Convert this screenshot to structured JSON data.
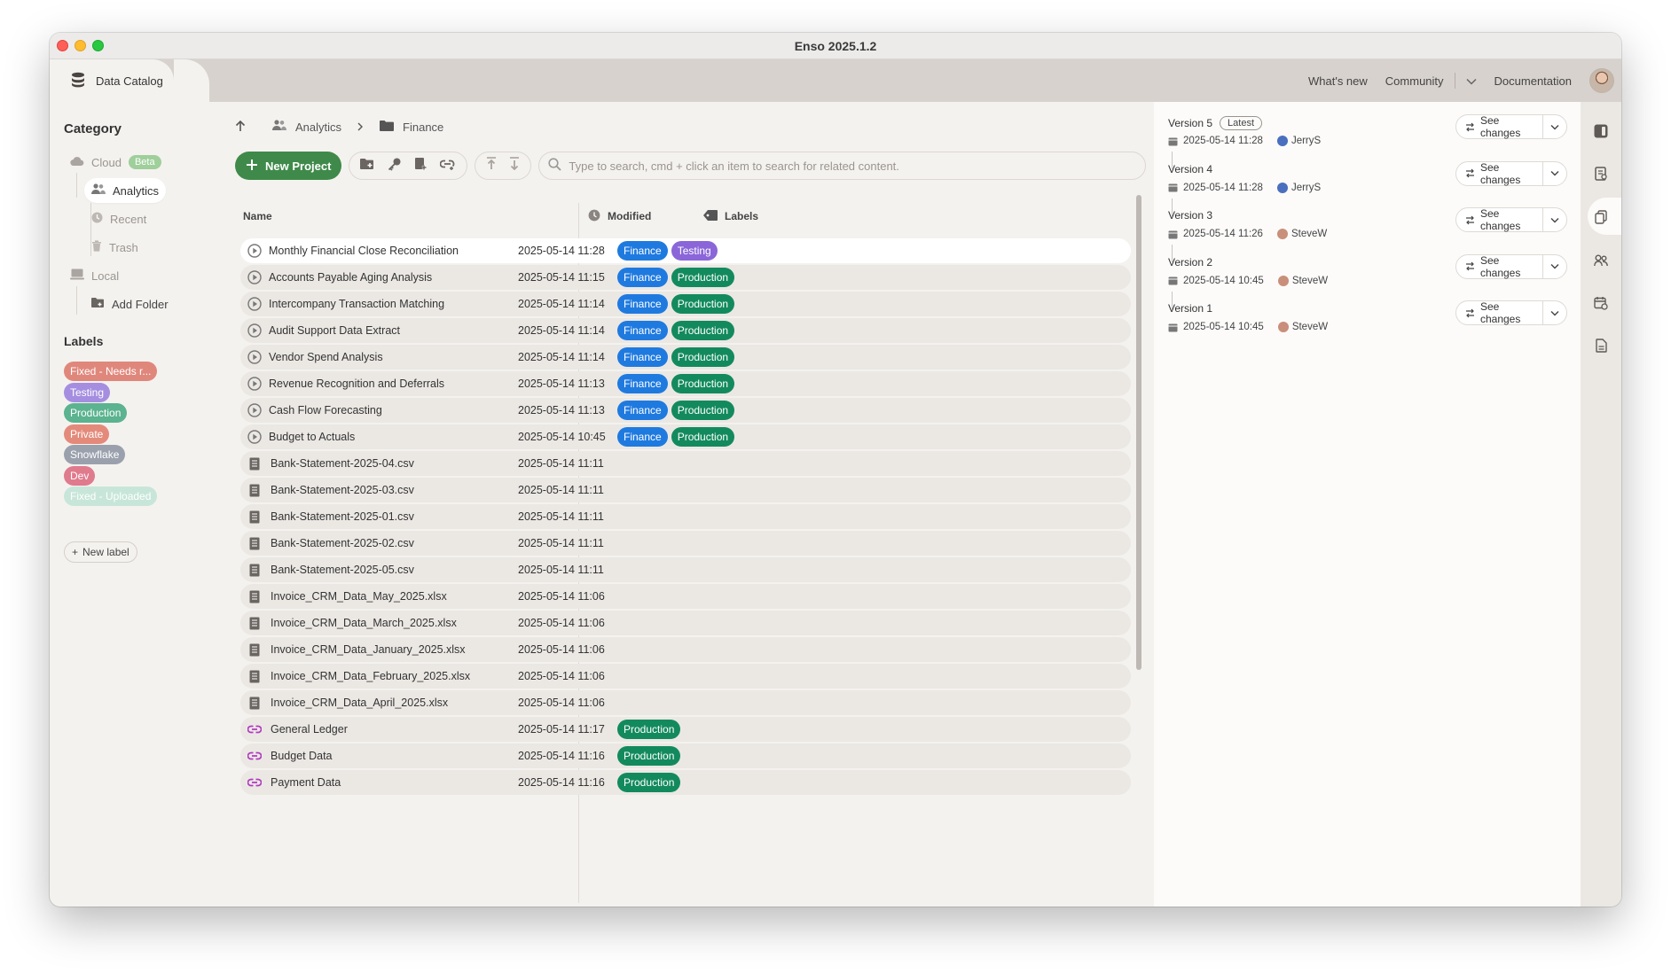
{
  "window": {
    "title": "Enso 2025.1.2"
  },
  "topbar": {
    "tab_label": "Data Catalog",
    "nav": [
      "What's new",
      "Community",
      "Documentation"
    ]
  },
  "sidebar": {
    "category_heading": "Category",
    "items": {
      "cloud": "Cloud",
      "beta": "Beta",
      "analytics": "Analytics",
      "recent": "Recent",
      "trash": "Trash",
      "local": "Local",
      "add_folder": "Add Folder"
    },
    "labels_heading": "Labels",
    "labels": [
      {
        "text": "Fixed - Needs r...",
        "color": "#e0877c"
      },
      {
        "text": "Testing",
        "color": "#a58ee0"
      },
      {
        "text": "Production",
        "color": "#5bb38f"
      },
      {
        "text": "Private",
        "color": "#e48a7b"
      },
      {
        "text": "Snowflake",
        "color": "#9aa1ad"
      },
      {
        "text": "Dev",
        "color": "#e07a8d"
      },
      {
        "text": "Fixed - Uploaded",
        "color": "#c7e6d9"
      }
    ],
    "new_label": "New label"
  },
  "breadcrumb": {
    "parent": "Analytics",
    "current": "Finance"
  },
  "toolbar": {
    "new_project": "New Project",
    "search_placeholder": "Type to search, cmd + click an item to search for related content."
  },
  "table": {
    "headers": {
      "name": "Name",
      "modified": "Modified",
      "labels": "Labels"
    },
    "rows": [
      {
        "name": "Monthly Financial Close Reconciliation",
        "modified": "2025-05-14 11:28",
        "type": "project",
        "labels": [
          "Finance",
          "Testing"
        ],
        "selected": true
      },
      {
        "name": "Accounts Payable Aging Analysis",
        "modified": "2025-05-14 11:15",
        "type": "project",
        "labels": [
          "Finance",
          "Production"
        ]
      },
      {
        "name": "Intercompany Transaction Matching",
        "modified": "2025-05-14 11:14",
        "type": "project",
        "labels": [
          "Finance",
          "Production"
        ]
      },
      {
        "name": "Audit Support Data Extract",
        "modified": "2025-05-14 11:14",
        "type": "project",
        "labels": [
          "Finance",
          "Production"
        ]
      },
      {
        "name": "Vendor Spend Analysis",
        "modified": "2025-05-14 11:14",
        "type": "project",
        "labels": [
          "Finance",
          "Production"
        ]
      },
      {
        "name": "Revenue Recognition and Deferrals",
        "modified": "2025-05-14 11:13",
        "type": "project",
        "labels": [
          "Finance",
          "Production"
        ]
      },
      {
        "name": "Cash Flow Forecasting",
        "modified": "2025-05-14 11:13",
        "type": "project",
        "labels": [
          "Finance",
          "Production"
        ]
      },
      {
        "name": "Budget to Actuals",
        "modified": "2025-05-14 10:45",
        "type": "project",
        "labels": [
          "Finance",
          "Production"
        ]
      },
      {
        "name": "Bank-Statement-2025-04.csv",
        "modified": "2025-05-14 11:11",
        "type": "file",
        "labels": []
      },
      {
        "name": "Bank-Statement-2025-03.csv",
        "modified": "2025-05-14 11:11",
        "type": "file",
        "labels": []
      },
      {
        "name": "Bank-Statement-2025-01.csv",
        "modified": "2025-05-14 11:11",
        "type": "file",
        "labels": []
      },
      {
        "name": "Bank-Statement-2025-02.csv",
        "modified": "2025-05-14 11:11",
        "type": "file",
        "labels": []
      },
      {
        "name": "Bank-Statement-2025-05.csv",
        "modified": "2025-05-14 11:11",
        "type": "file",
        "labels": []
      },
      {
        "name": "Invoice_CRM_Data_May_2025.xlsx",
        "modified": "2025-05-14 11:06",
        "type": "file",
        "labels": []
      },
      {
        "name": "Invoice_CRM_Data_March_2025.xlsx",
        "modified": "2025-05-14 11:06",
        "type": "file",
        "labels": []
      },
      {
        "name": "Invoice_CRM_Data_January_2025.xlsx",
        "modified": "2025-05-14 11:06",
        "type": "file",
        "labels": []
      },
      {
        "name": "Invoice_CRM_Data_February_2025.xlsx",
        "modified": "2025-05-14 11:06",
        "type": "file",
        "labels": []
      },
      {
        "name": "Invoice_CRM_Data_April_2025.xlsx",
        "modified": "2025-05-14 11:06",
        "type": "file",
        "labels": []
      },
      {
        "name": "General Ledger",
        "modified": "2025-05-14 11:17",
        "type": "datalink",
        "labels": [
          "Production"
        ]
      },
      {
        "name": "Budget Data",
        "modified": "2025-05-14 11:16",
        "type": "datalink",
        "labels": [
          "Production"
        ]
      },
      {
        "name": "Payment Data",
        "modified": "2025-05-14 11:16",
        "type": "datalink",
        "labels": [
          "Production"
        ]
      }
    ]
  },
  "tag_colors": {
    "Finance": "#1f7ae0",
    "Testing": "#8a66d9",
    "Production": "#138a5e"
  },
  "versions": {
    "latest_label": "Latest",
    "see_changes": "See changes",
    "items": [
      {
        "title": "Version 5",
        "date": "2025-05-14 11:28",
        "user": "JerryS",
        "latest": true
      },
      {
        "title": "Version 4",
        "date": "2025-05-14 11:28",
        "user": "JerryS"
      },
      {
        "title": "Version 3",
        "date": "2025-05-14 11:26",
        "user": "SteveW"
      },
      {
        "title": "Version 2",
        "date": "2025-05-14 10:45",
        "user": "SteveW"
      },
      {
        "title": "Version 1",
        "date": "2025-05-14 10:45",
        "user": "SteveW"
      }
    ]
  }
}
